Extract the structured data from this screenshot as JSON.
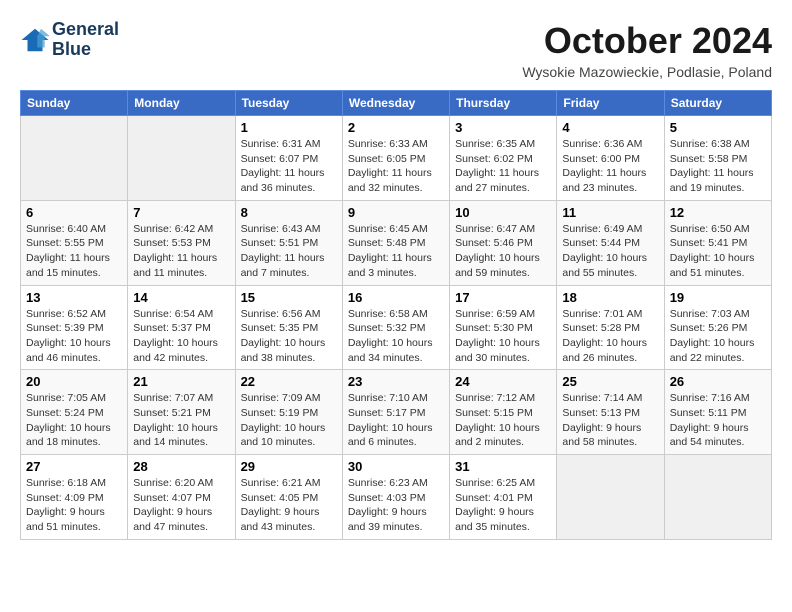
{
  "header": {
    "logo_line1": "General",
    "logo_line2": "Blue",
    "month": "October 2024",
    "location": "Wysokie Mazowieckie, Podlasie, Poland"
  },
  "weekdays": [
    "Sunday",
    "Monday",
    "Tuesday",
    "Wednesday",
    "Thursday",
    "Friday",
    "Saturday"
  ],
  "weeks": [
    [
      {
        "day": "",
        "info": ""
      },
      {
        "day": "",
        "info": ""
      },
      {
        "day": "1",
        "info": "Sunrise: 6:31 AM\nSunset: 6:07 PM\nDaylight: 11 hours and 36 minutes."
      },
      {
        "day": "2",
        "info": "Sunrise: 6:33 AM\nSunset: 6:05 PM\nDaylight: 11 hours and 32 minutes."
      },
      {
        "day": "3",
        "info": "Sunrise: 6:35 AM\nSunset: 6:02 PM\nDaylight: 11 hours and 27 minutes."
      },
      {
        "day": "4",
        "info": "Sunrise: 6:36 AM\nSunset: 6:00 PM\nDaylight: 11 hours and 23 minutes."
      },
      {
        "day": "5",
        "info": "Sunrise: 6:38 AM\nSunset: 5:58 PM\nDaylight: 11 hours and 19 minutes."
      }
    ],
    [
      {
        "day": "6",
        "info": "Sunrise: 6:40 AM\nSunset: 5:55 PM\nDaylight: 11 hours and 15 minutes."
      },
      {
        "day": "7",
        "info": "Sunrise: 6:42 AM\nSunset: 5:53 PM\nDaylight: 11 hours and 11 minutes."
      },
      {
        "day": "8",
        "info": "Sunrise: 6:43 AM\nSunset: 5:51 PM\nDaylight: 11 hours and 7 minutes."
      },
      {
        "day": "9",
        "info": "Sunrise: 6:45 AM\nSunset: 5:48 PM\nDaylight: 11 hours and 3 minutes."
      },
      {
        "day": "10",
        "info": "Sunrise: 6:47 AM\nSunset: 5:46 PM\nDaylight: 10 hours and 59 minutes."
      },
      {
        "day": "11",
        "info": "Sunrise: 6:49 AM\nSunset: 5:44 PM\nDaylight: 10 hours and 55 minutes."
      },
      {
        "day": "12",
        "info": "Sunrise: 6:50 AM\nSunset: 5:41 PM\nDaylight: 10 hours and 51 minutes."
      }
    ],
    [
      {
        "day": "13",
        "info": "Sunrise: 6:52 AM\nSunset: 5:39 PM\nDaylight: 10 hours and 46 minutes."
      },
      {
        "day": "14",
        "info": "Sunrise: 6:54 AM\nSunset: 5:37 PM\nDaylight: 10 hours and 42 minutes."
      },
      {
        "day": "15",
        "info": "Sunrise: 6:56 AM\nSunset: 5:35 PM\nDaylight: 10 hours and 38 minutes."
      },
      {
        "day": "16",
        "info": "Sunrise: 6:58 AM\nSunset: 5:32 PM\nDaylight: 10 hours and 34 minutes."
      },
      {
        "day": "17",
        "info": "Sunrise: 6:59 AM\nSunset: 5:30 PM\nDaylight: 10 hours and 30 minutes."
      },
      {
        "day": "18",
        "info": "Sunrise: 7:01 AM\nSunset: 5:28 PM\nDaylight: 10 hours and 26 minutes."
      },
      {
        "day": "19",
        "info": "Sunrise: 7:03 AM\nSunset: 5:26 PM\nDaylight: 10 hours and 22 minutes."
      }
    ],
    [
      {
        "day": "20",
        "info": "Sunrise: 7:05 AM\nSunset: 5:24 PM\nDaylight: 10 hours and 18 minutes."
      },
      {
        "day": "21",
        "info": "Sunrise: 7:07 AM\nSunset: 5:21 PM\nDaylight: 10 hours and 14 minutes."
      },
      {
        "day": "22",
        "info": "Sunrise: 7:09 AM\nSunset: 5:19 PM\nDaylight: 10 hours and 10 minutes."
      },
      {
        "day": "23",
        "info": "Sunrise: 7:10 AM\nSunset: 5:17 PM\nDaylight: 10 hours and 6 minutes."
      },
      {
        "day": "24",
        "info": "Sunrise: 7:12 AM\nSunset: 5:15 PM\nDaylight: 10 hours and 2 minutes."
      },
      {
        "day": "25",
        "info": "Sunrise: 7:14 AM\nSunset: 5:13 PM\nDaylight: 9 hours and 58 minutes."
      },
      {
        "day": "26",
        "info": "Sunrise: 7:16 AM\nSunset: 5:11 PM\nDaylight: 9 hours and 54 minutes."
      }
    ],
    [
      {
        "day": "27",
        "info": "Sunrise: 6:18 AM\nSunset: 4:09 PM\nDaylight: 9 hours and 51 minutes."
      },
      {
        "day": "28",
        "info": "Sunrise: 6:20 AM\nSunset: 4:07 PM\nDaylight: 9 hours and 47 minutes."
      },
      {
        "day": "29",
        "info": "Sunrise: 6:21 AM\nSunset: 4:05 PM\nDaylight: 9 hours and 43 minutes."
      },
      {
        "day": "30",
        "info": "Sunrise: 6:23 AM\nSunset: 4:03 PM\nDaylight: 9 hours and 39 minutes."
      },
      {
        "day": "31",
        "info": "Sunrise: 6:25 AM\nSunset: 4:01 PM\nDaylight: 9 hours and 35 minutes."
      },
      {
        "day": "",
        "info": ""
      },
      {
        "day": "",
        "info": ""
      }
    ]
  ]
}
